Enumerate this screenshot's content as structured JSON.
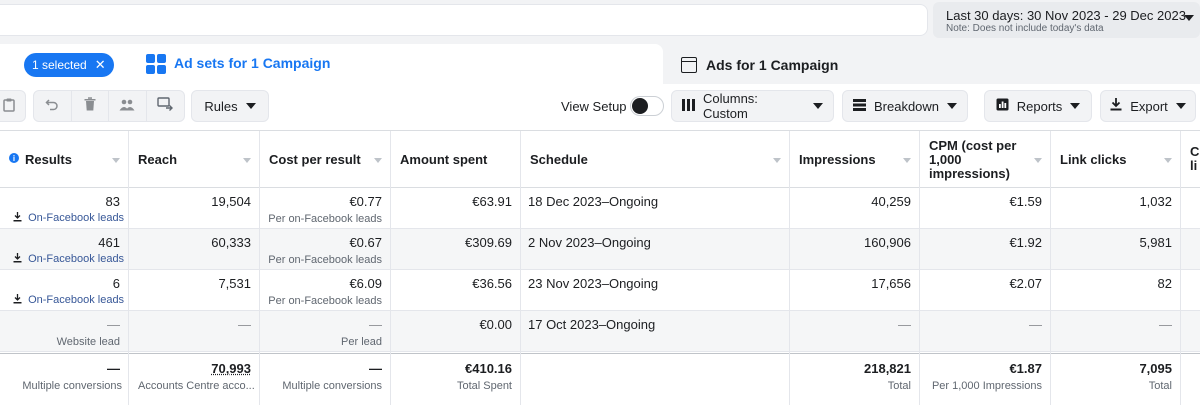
{
  "date_range": {
    "main": "Last 30 days: 30 Nov 2023 - 29 Dec 2023",
    "note": "Note: Does not include today's data"
  },
  "tabs": {
    "selected_pill": "1 selected",
    "pill_close": "✕",
    "active": "Ad sets for 1 Campaign",
    "ads": "Ads for 1 Campaign"
  },
  "toolbar": {
    "rules": "Rules",
    "view_setup": "View Setup",
    "columns": "Columns: Custom",
    "breakdown": "Breakdown",
    "reports": "Reports",
    "export": "Export"
  },
  "columns": {
    "results": "Results",
    "reach": "Reach",
    "cost_per_result": "Cost per result",
    "amount_spent": "Amount spent",
    "schedule": "Schedule",
    "impressions": "Impressions",
    "cpm": "CPM (cost per 1,000 impressions)",
    "link_clicks": "Link clicks",
    "cut": "Cl li"
  },
  "rows": [
    {
      "results": "83",
      "results_type": "On-Facebook leads",
      "reach": "19,504",
      "cpr": "€0.77",
      "cpr_sub": "Per on-Facebook leads",
      "spent": "€63.91",
      "schedule": "18 Dec 2023–Ongoing",
      "impressions": "40,259",
      "cpm": "€1.59",
      "clicks": "1,032"
    },
    {
      "results": "461",
      "results_type": "On-Facebook leads",
      "reach": "60,333",
      "cpr": "€0.67",
      "cpr_sub": "Per on-Facebook leads",
      "spent": "€309.69",
      "schedule": "2 Nov 2023–Ongoing",
      "impressions": "160,906",
      "cpm": "€1.92",
      "clicks": "5,981"
    },
    {
      "results": "6",
      "results_type": "On-Facebook leads",
      "reach": "7,531",
      "cpr": "€6.09",
      "cpr_sub": "Per on-Facebook leads",
      "spent": "€36.56",
      "schedule": "23 Nov 2023–Ongoing",
      "impressions": "17,656",
      "cpm": "€2.07",
      "clicks": "82"
    },
    {
      "results": "—",
      "results_type": "Website lead",
      "reach": "—",
      "cpr": "—",
      "cpr_sub": "Per lead",
      "spent": "€0.00",
      "schedule": "17 Oct 2023–Ongoing",
      "impressions": "—",
      "cpm": "—",
      "clicks": "—"
    }
  ],
  "totals": {
    "results": "—",
    "results_sub": "Multiple conversions",
    "reach": "70,993",
    "reach_sub": "Accounts Centre acco...",
    "cpr": "—",
    "cpr_sub": "Multiple conversions",
    "spent": "€410.16",
    "spent_sub": "Total Spent",
    "impressions": "218,821",
    "impressions_sub": "Total",
    "cpm": "€1.87",
    "cpm_sub": "Per 1,000 Impressions",
    "clicks": "7,095",
    "clicks_sub": "Total"
  }
}
